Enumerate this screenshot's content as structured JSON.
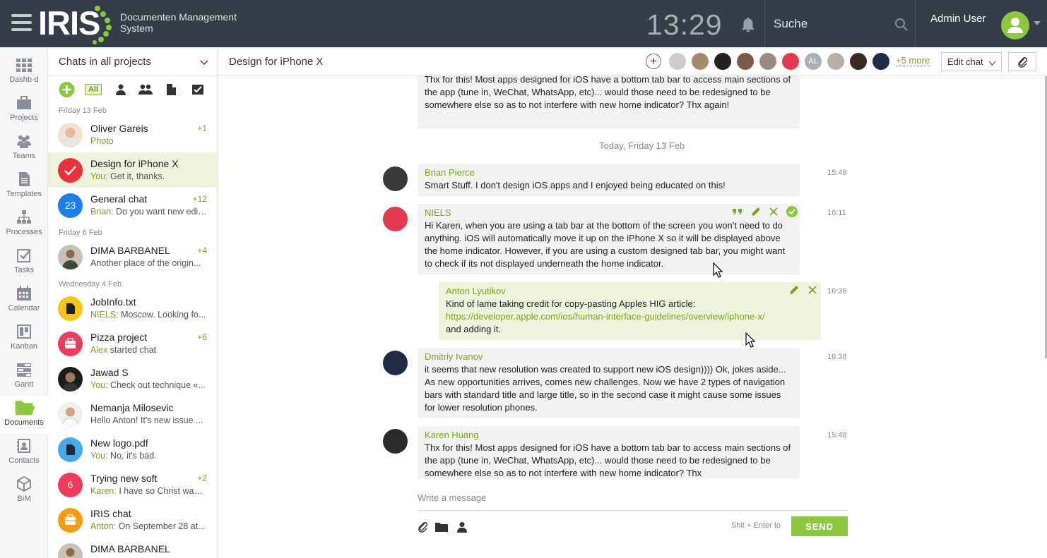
{
  "header": {
    "logo": "IRIS",
    "subtitle_line1": "Documenten Management",
    "subtitle_line2": "System",
    "clock": "13:29",
    "search_placeholder": "Suche",
    "user_name": "Admin User",
    "accent": "#8dc63f",
    "bar_color": "#353d48"
  },
  "nav": [
    {
      "label": "Dashb-d",
      "icon": "dashboard-grid-icon"
    },
    {
      "label": "Projects",
      "icon": "briefcase-icon"
    },
    {
      "label": "Teams",
      "icon": "team-icon"
    },
    {
      "label": "Templates",
      "icon": "template-document-icon"
    },
    {
      "label": "Processes",
      "icon": "process-tree-icon"
    },
    {
      "label": "Tasks",
      "icon": "task-check-icon"
    },
    {
      "label": "Calendar",
      "icon": "calendar-icon"
    },
    {
      "label": "Kanban",
      "icon": "kanban-icon"
    },
    {
      "label": "Gantt",
      "icon": "gantt-icon"
    },
    {
      "label": "Documents",
      "icon": "folder-open-icon",
      "active": true
    },
    {
      "label": "Contacts",
      "icon": "contacts-icon"
    },
    {
      "label": "BIM",
      "icon": "cube-icon"
    }
  ],
  "chatlist": {
    "title": "Chats in all projects",
    "filter_all": "All",
    "day_friday": "Friday 13 Feb",
    "day_friday6": "Friday 6 Feb",
    "day_wed": "Wednesday 4 Feb",
    "chats": [
      {
        "name": "Oliver Gareis",
        "prefix": "",
        "preview": "Photo",
        "count": "+1"
      },
      {
        "name": "Design for iPhone X",
        "prefix": "You:",
        "preview": " Get it, thanks.",
        "count": ""
      },
      {
        "name": "General chat",
        "prefix": "Brian:",
        "preview": " Do you want new editi...",
        "count": "+12",
        "badge": "23"
      },
      {
        "name": "DIMA BARBANEL",
        "prefix": "",
        "preview": "Another place of the origin...",
        "count": "+4"
      },
      {
        "name": "JobInfo.txt",
        "prefix": "NIELS:",
        "preview": "  Moscow. Looking fo...",
        "count": ""
      },
      {
        "name": "Pizza project",
        "prefix": "Alex",
        "preview": " started chat",
        "count": "+6"
      },
      {
        "name": "Jawad S",
        "prefix": "You:",
        "preview": " Check out technique «...",
        "count": ""
      },
      {
        "name": "Nemanja Milosevic",
        "prefix": "",
        "preview": "Hello Anton! It's new issue ...",
        "count": ""
      },
      {
        "name": "New logo.pdf",
        "prefix": "You:",
        "preview": " No, it's bad.",
        "count": ""
      },
      {
        "name": "Trying new soft",
        "prefix": "Karen:",
        "preview": " I have so Christ was ...",
        "count": "+2",
        "badge": "6"
      },
      {
        "name": "IRIS chat",
        "prefix": "Anton:",
        "preview": " On September 28 at...",
        "count": ""
      },
      {
        "name": "DIMA BARBANEL",
        "prefix": "",
        "preview": "",
        "count": ""
      }
    ]
  },
  "main": {
    "title": "Design for iPhone X",
    "more_members": "+5 more",
    "member_initials": "AL",
    "edit_chat": "Edit chat",
    "today": "Today, Friday 13 Feb",
    "messages": [
      {
        "author": "",
        "text": "Thx for this! Most apps designed for iOS have a bottom tab bar to access main sections of the app (tune in, WeChat, WhatsApp, etc)... would those need to be redesigned to be somewhere else so as to not interfere with new home indicator? Thx again!",
        "time": ""
      },
      {
        "author": "Brian Pierce",
        "text": "Smart Stuff. I don't design iOS apps and I enjoyed being educated on this!",
        "time": "15:48"
      },
      {
        "author": "NIELS",
        "text": "Hi Karen, when you are using a tab bar at the bottom of the screen you won't need to do anything. iOS will automatically move it up on the iPhone X so it will be displayed above the home indicator. However, if you are using a custom designed tab bar, you might want to check if its not displayed underneath the home indicator.",
        "time": "16:11"
      },
      {
        "author": "Anton Lyutikov",
        "text": "Kind of lame taking credit for copy-pasting Apples HIG article:",
        "link": "https://developer.apple.com/ios/human-interface-guidelines/overview/iphone-x/",
        "text2": "and adding it.",
        "time": "16:36"
      },
      {
        "author": "Dmitriy Ivanov",
        "text": "it seems that new resolution was created to support new iOS design)))) Ok, jokes aside... As new opportunities arrives, comes new challenges. Now we have 2 types of navigation bars with standard title and large title, so in the second case it might cause some issues for lower resolution phones.",
        "time": "16:38"
      },
      {
        "author": "Karen Huang",
        "text": "Thx for this! Most apps designed for iOS have a bottom tab bar to access main sections of the app (tune in, WeChat, WhatsApp, etc)... would those need to be redesigned to be somewhere else so as to not interfere with new home indicator? Thx",
        "time": "15:48"
      }
    ],
    "composer_placeholder": "Write a message",
    "send_hint": "Shit + Enter to",
    "send": "SEND"
  }
}
